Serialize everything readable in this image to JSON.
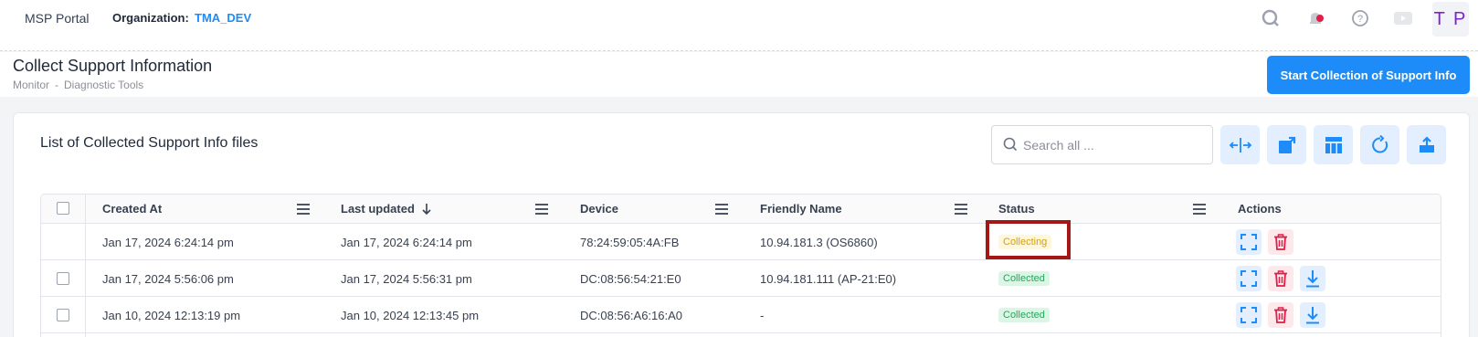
{
  "topbar": {
    "brand": "MSP Portal",
    "org_label": "Organization:",
    "org_value": "TMA_DEV",
    "icons": [
      "search-icon",
      "bell-icon",
      "help-icon",
      "video-icon"
    ],
    "notification_color": "#e11d48",
    "avatar_initials": "T P"
  },
  "page": {
    "title": "Collect Support Information",
    "breadcrumb": [
      "Monitor",
      "-",
      "Diagnostic Tools"
    ],
    "primary_action": "Start Collection of Support Info",
    "accent_color": "#1d8cf8"
  },
  "card": {
    "title": "List of Collected Support Info files",
    "search_placeholder": "Search all ...",
    "toolbar_icons": [
      "fit-columns-icon",
      "export-icon",
      "table-layout-icon",
      "refresh-icon",
      "upload-icon"
    ]
  },
  "table": {
    "columns": [
      "Created At",
      "Last updated",
      "Device",
      "Friendly Name",
      "Status",
      "Actions"
    ],
    "sort_column": "Last updated",
    "rows": [
      {
        "created_at": "Jan 17, 2024 6:24:14 pm",
        "last_updated": "Jan 17, 2024 6:24:14 pm",
        "device": "78:24:59:05:4A:FB",
        "friendly_name": "10.94.181.3 (OS6860)",
        "status": "Collecting",
        "has_checkbox": false,
        "actions": [
          "expand-icon",
          "delete-icon"
        ]
      },
      {
        "created_at": "Jan 17, 2024 5:56:06 pm",
        "last_updated": "Jan 17, 2024 5:56:31 pm",
        "device": "DC:08:56:54:21:E0",
        "friendly_name": "10.94.181.111 (AP-21:E0)",
        "status": "Collected",
        "has_checkbox": true,
        "actions": [
          "expand-icon",
          "delete-icon",
          "download-icon"
        ]
      },
      {
        "created_at": "Jan 10, 2024 12:13:19 pm",
        "last_updated": "Jan 10, 2024 12:13:45 pm",
        "device": "DC:08:56:A6:16:A0",
        "friendly_name": "-",
        "status": "Collected",
        "has_checkbox": true,
        "actions": [
          "expand-icon",
          "delete-icon",
          "download-icon"
        ]
      }
    ],
    "status_colors": {
      "Collecting": "#d4a00a",
      "Collected": "#22a55a"
    },
    "highlight_color": "#a31717"
  }
}
